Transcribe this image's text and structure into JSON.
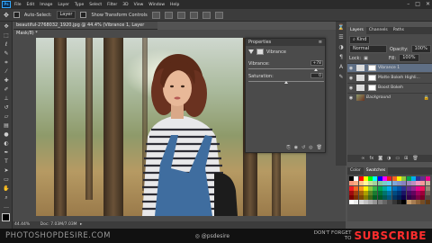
{
  "menu": {
    "logo": "Ps",
    "items": [
      "File",
      "Edit",
      "Image",
      "Layer",
      "Type",
      "Select",
      "Filter",
      "3D",
      "View",
      "Window",
      "Help"
    ]
  },
  "options": {
    "auto_select_label": "Auto-Select:",
    "auto_select_value": "Layer",
    "show_transform_label": "Show Transform Controls"
  },
  "document": {
    "tab_title": "beautiful-2768032_1920.jpg @ 44.4% (Vibrance 1, Layer Mask/8) *",
    "zoom": "44.44%",
    "doc_info": "Doc: 7.03M/7.03M"
  },
  "properties": {
    "title": "Properties",
    "adjustment": "Vibrance",
    "vibrance_label": "Vibrance:",
    "vibrance_value": "+78",
    "vibrance_fraction": 0.89,
    "saturation_label": "Saturation:",
    "saturation_value": "0",
    "saturation_fraction": 0.5
  },
  "layers_panel": {
    "tabs": [
      "Layers",
      "Channels",
      "Paths"
    ],
    "kind_label": "Kind",
    "blend_mode": "Normal",
    "opacity_label": "Opacity:",
    "opacity_value": "100%",
    "lock_label": "Lock:",
    "fill_label": "Fill:",
    "fill_value": "100%",
    "layers": [
      {
        "name": "Vibrance 1"
      },
      {
        "name": "Matte Bokeh Highli..."
      },
      {
        "name": "Boost Bokeh"
      },
      {
        "name": "Background"
      }
    ]
  },
  "swatches_panel": {
    "tabs": [
      "Color",
      "Swatches"
    ],
    "colors": [
      "#000000",
      "#ffffff",
      "#ff0000",
      "#ffff00",
      "#00ff00",
      "#00ffff",
      "#0000ff",
      "#ff00ff",
      "#ed1c24",
      "#f26522",
      "#fff200",
      "#8dc63f",
      "#00a651",
      "#00aeef",
      "#2e3192",
      "#662d91",
      "#ec008c",
      "#f7977a",
      "#f9ad81",
      "#fdc68a",
      "#fff79a",
      "#c4df9b",
      "#a3d39c",
      "#82ca9d",
      "#7bcdc8",
      "#6ecff6",
      "#7ea7d8",
      "#8493ca",
      "#8882be",
      "#a187be",
      "#bc8dbf",
      "#f49ac2",
      "#f6989d",
      "#c7b299",
      "#ed1c24",
      "#f26522",
      "#f7941d",
      "#fff200",
      "#8dc63f",
      "#39b54a",
      "#00a651",
      "#00a99d",
      "#00aeef",
      "#0072bc",
      "#0054a6",
      "#2e3192",
      "#662d91",
      "#92278f",
      "#ec008c",
      "#ed145b",
      "#998675",
      "#9e0b0f",
      "#a0410d",
      "#a36209",
      "#aba000",
      "#598527",
      "#1a7b30",
      "#007236",
      "#00746b",
      "#0076a3",
      "#004b80",
      "#003471",
      "#1b1464",
      "#440e62",
      "#630460",
      "#9e005d",
      "#9e0039",
      "#736357",
      "#790000",
      "#7b2e00",
      "#7d4900",
      "#827b00",
      "#406618",
      "#005e20",
      "#005826",
      "#005952",
      "#005b7f",
      "#003663",
      "#002157",
      "#0d004c",
      "#32004b",
      "#4b0049",
      "#7b0046",
      "#7a0026",
      "#534741",
      "#ffffff",
      "#ebebeb",
      "#d7d7d7",
      "#c2c2c2",
      "#acacac",
      "#959595",
      "#7e7e7e",
      "#666666",
      "#4e4e4e",
      "#363636",
      "#1e1e1e",
      "#000000",
      "#c69c6d",
      "#a67c52",
      "#8c6239",
      "#754c24",
      "#603913"
    ]
  },
  "watermark": {
    "left": "PHOTOSHOPDESIRE.COM",
    "mid": "@psdesire",
    "small_1": "DON'T FORGET",
    "small_2": "TO",
    "subscribe": "SUBSCRIBE"
  }
}
